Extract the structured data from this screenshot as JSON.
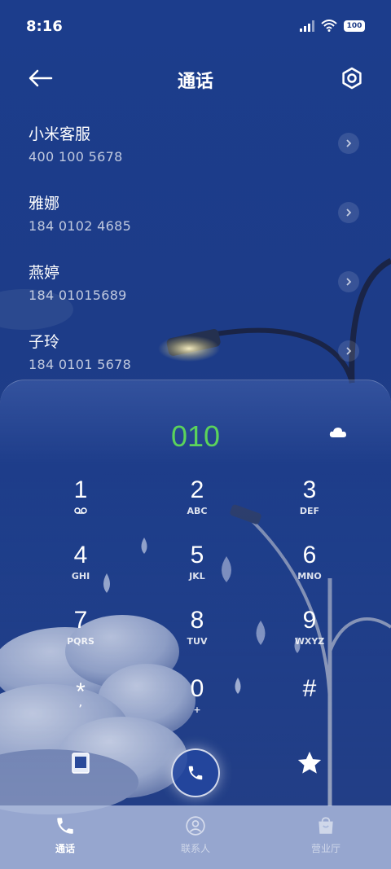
{
  "status_bar": {
    "time": "8:16",
    "battery": "100"
  },
  "app_bar": {
    "title": "通话"
  },
  "recent_calls": [
    {
      "name": "小米客服",
      "number": "400 100 5678"
    },
    {
      "name": "雅娜",
      "number": "184 0102 4685"
    },
    {
      "name": "燕婷",
      "number": "184 01015689"
    },
    {
      "name": "子玲",
      "number": "184 0101 5678"
    }
  ],
  "dialpad": {
    "input": "010",
    "input_color": "#5bd35b",
    "keys": [
      {
        "digit": "1",
        "letters": ""
      },
      {
        "digit": "2",
        "letters": "ABC"
      },
      {
        "digit": "3",
        "letters": "DEF"
      },
      {
        "digit": "4",
        "letters": "GHI"
      },
      {
        "digit": "5",
        "letters": "JKL"
      },
      {
        "digit": "6",
        "letters": "MNO"
      },
      {
        "digit": "7",
        "letters": "PQRS"
      },
      {
        "digit": "8",
        "letters": "TUV"
      },
      {
        "digit": "9",
        "letters": "WXYZ"
      },
      {
        "digit": "*",
        "letters": ","
      },
      {
        "digit": "0",
        "letters": "+"
      },
      {
        "digit": "#",
        "letters": ""
      }
    ],
    "icons": {
      "voicemail": "voicemail-icon",
      "cloud": "cloud-icon",
      "contact_card": "contact-card-icon",
      "call": "phone-icon",
      "favorites": "star-icon"
    }
  },
  "bottom_nav": {
    "tabs": [
      {
        "label": "通话",
        "icon": "phone-icon",
        "active": true
      },
      {
        "label": "联系人",
        "icon": "person-icon",
        "active": false
      },
      {
        "label": "营业厅",
        "icon": "store-icon",
        "active": false
      }
    ]
  }
}
